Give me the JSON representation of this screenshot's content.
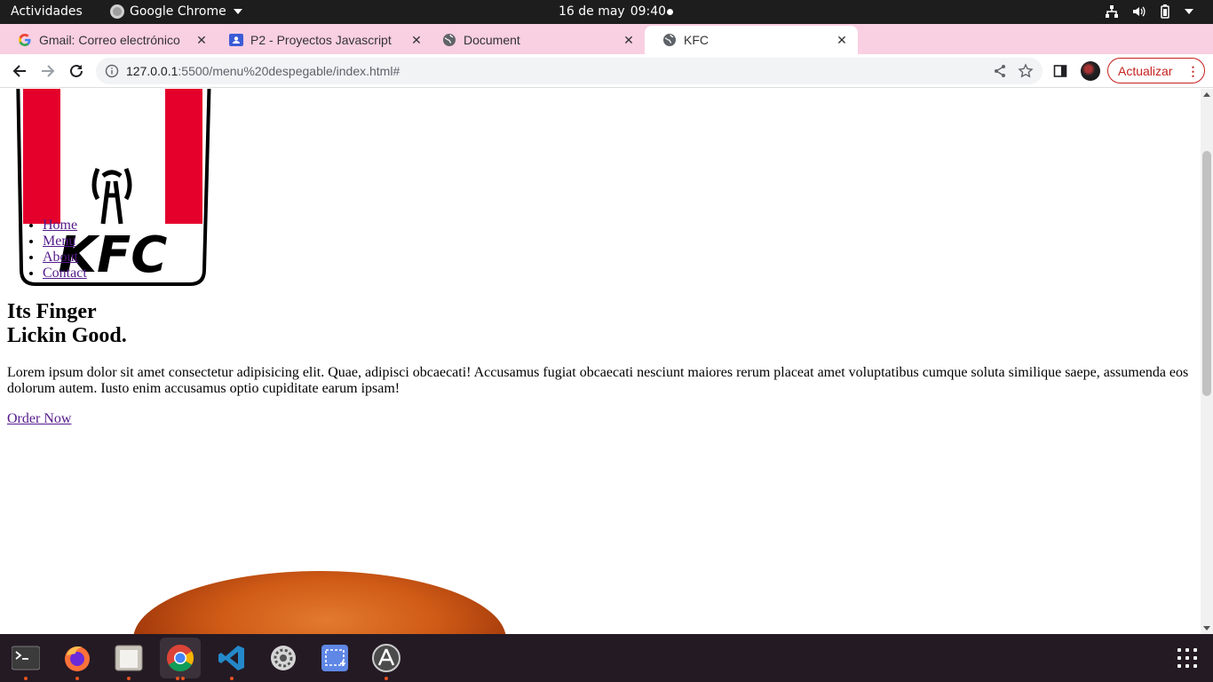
{
  "topbar": {
    "activities": "Actividades",
    "app_name": "Google Chrome",
    "date": "16 de may",
    "time": "09:40"
  },
  "tabs": [
    {
      "title": "Gmail: Correo electrónico",
      "favicon": "google-g-icon",
      "active": false
    },
    {
      "title": "P2 - Proyectos Javascript",
      "favicon": "classroom-icon",
      "active": false
    },
    {
      "title": "Document",
      "favicon": "globe-icon",
      "active": false
    },
    {
      "title": "KFC",
      "favicon": "globe-icon",
      "active": true
    }
  ],
  "address_bar": {
    "url_host": "127.0.0.1",
    "url_rest": ":5500/menu%20despegable/index.html#"
  },
  "update_button": "Actualizar",
  "page": {
    "logo_text": "KFC",
    "nav": [
      "Home",
      "Menu",
      "About",
      "Contact"
    ],
    "title_line1": "Its Finger",
    "title_line2": "Lickin Good.",
    "paragraph": "Lorem ipsum dolor sit amet consectetur adipisicing elit. Quae, adipisci obcaecati! Accusamus fugiat obcaecati nesciunt maiores rerum placeat amet voluptatibus cumque soluta similique saepe, assumenda eos dolorum autem. Iusto enim accusamus optio cupiditate earum ipsam!",
    "cta": "Order Now"
  },
  "dock": [
    {
      "name": "terminal-icon",
      "running": true
    },
    {
      "name": "firefox-icon",
      "running": true
    },
    {
      "name": "files-icon",
      "running": true
    },
    {
      "name": "chrome-icon",
      "running": true
    },
    {
      "name": "vscode-icon",
      "running": true
    },
    {
      "name": "settings-icon",
      "running": false
    },
    {
      "name": "screenshot-icon",
      "running": false
    },
    {
      "name": "software-updater-icon",
      "running": true
    }
  ],
  "colors": {
    "tabstrip": "#f9cfe2",
    "kfc_red": "#e4002b",
    "update_red": "#c5221f",
    "link_visited": "#551a8b"
  }
}
